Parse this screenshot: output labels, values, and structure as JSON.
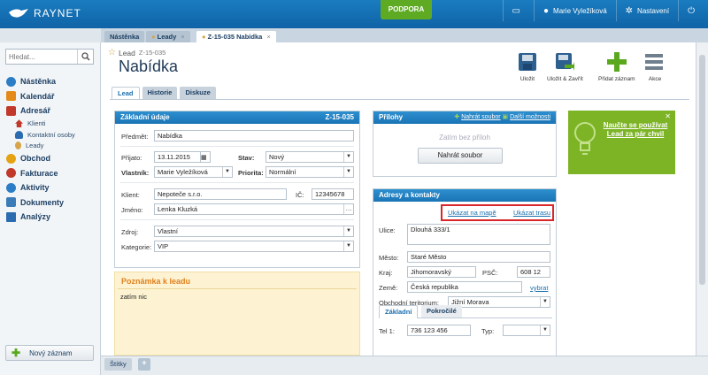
{
  "app": {
    "logo": "RAYNET",
    "support": "PODPORA",
    "user": "Marie Vyležíková",
    "settings": "Nastavení"
  },
  "search": {
    "placeholder": "Hledat..."
  },
  "nav": {
    "items": [
      "Nástěnka",
      "Kalendář",
      "Adresář"
    ],
    "sub": [
      "Klienti",
      "Kontaktní osoby",
      "Leady"
    ],
    "items2": [
      "Obchod",
      "Fakturace",
      "Aktivity",
      "Dokumenty",
      "Analýzy"
    ]
  },
  "new_record": "Nový záznam",
  "window_tabs": [
    "Nástěnka",
    "Leady",
    "Z-15-035 Nabídka"
  ],
  "header": {
    "type": "Lead",
    "code": "Z-15-035",
    "title": "Nabídka"
  },
  "toolbar": [
    "Uložit",
    "Uložit & Zavřít",
    "Přidat záznam",
    "Akce"
  ],
  "content_tabs": [
    "Lead",
    "Historie",
    "Diskuze"
  ],
  "basic": {
    "title": "Základní údaje",
    "code": "Z-15-035",
    "subject_label": "Předmět:",
    "subject": "Nabídka",
    "received_label": "Přijato:",
    "received": "13.11.2015",
    "status_label": "Stav:",
    "status": "Nový",
    "owner_label": "Vlastník:",
    "owner": "Marie Vyležíková",
    "priority_label": "Priorita:",
    "priority": "Normální",
    "client_label": "Klient:",
    "client": "Nepoteče s.r.o.",
    "ico_label": "IČ:",
    "ico": "12345678",
    "name_label": "Jméno:",
    "name": "Lenka Kluzká",
    "source_label": "Zdroj:",
    "source": "Vlastní",
    "category_label": "Kategorie:",
    "category": "VIP"
  },
  "note": {
    "title": "Poznámka k leadu",
    "text": "zatím nic"
  },
  "attachments": {
    "title": "Přílohy",
    "upload_link": "Nahrát soubor",
    "more": "Další možnosti",
    "empty": "Zatím bez příloh",
    "upload_btn": "Nahrát soubor"
  },
  "address": {
    "title": "Adresy a kontakty",
    "map_link": "Ukázat na mapě",
    "route_link": "Ukázat trasu",
    "street_label": "Ulice:",
    "street": "Dlouhá 333/1",
    "city_label": "Město:",
    "city": "Staré Město",
    "region_label": "Kraj:",
    "region": "Jihomoravský",
    "zip_label": "PSČ:",
    "zip": "608 12",
    "country_label": "Země:",
    "country": "Česká republika",
    "choose": "vybrat",
    "territory_label": "Obchodní teritorium:",
    "territory": "Jižní Morava",
    "tabs": [
      "Základní",
      "Pokročilé"
    ],
    "tel_label": "Tel 1:",
    "tel": "736 123 456",
    "type_label": "Typ:"
  },
  "promo": {
    "text": "Naučte se používat Lead za pár chvil"
  },
  "bottom": {
    "tags": "Štítky"
  }
}
